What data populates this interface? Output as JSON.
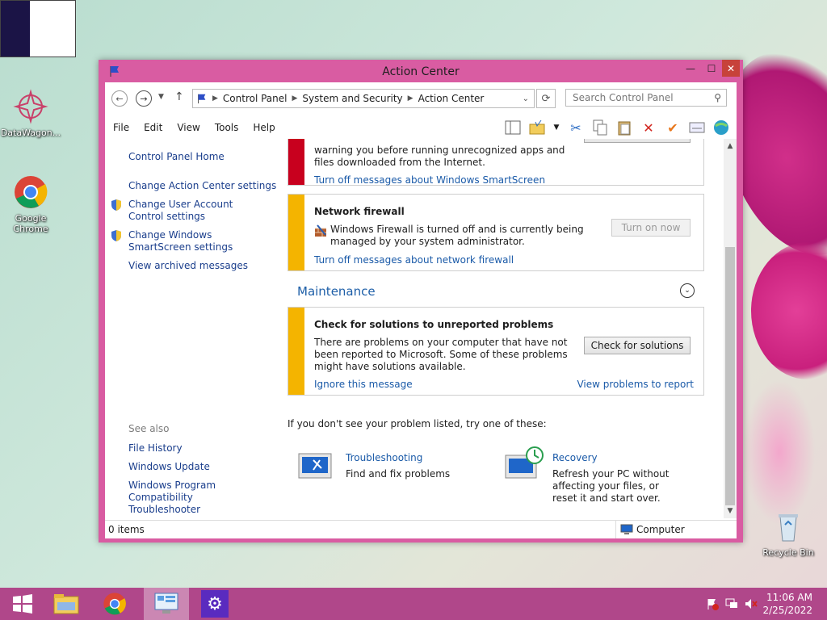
{
  "desktop": {
    "icons": [
      {
        "label": "DataWagon..."
      },
      {
        "label": "Google Chrome"
      },
      {
        "label": "Recycle Bin"
      }
    ]
  },
  "window": {
    "title": "Action Center",
    "controls": {
      "minimize": "—",
      "maximize": "☐",
      "close": "✕"
    },
    "address": {
      "segments": [
        "Control Panel",
        "System and Security",
        "Action Center"
      ],
      "search_placeholder": "Search Control Panel"
    },
    "menu": [
      "File",
      "Edit",
      "View",
      "Tools",
      "Help"
    ],
    "sidebar": {
      "home": "Control Panel Home",
      "links": [
        "Change Action Center settings",
        "Change User Account Control settings",
        "Change Windows SmartScreen settings",
        "View archived messages"
      ],
      "see_also_label": "See also",
      "see_also": [
        "File History",
        "Windows Update",
        "Windows Program Compatibility Troubleshooter"
      ]
    },
    "smartscreen_card": {
      "text": "warning you before running unrecognized apps and files downloaded from the Internet.",
      "link": "Turn off messages about Windows SmartScreen"
    },
    "firewall_card": {
      "heading": "Network firewall",
      "text": "Windows Firewall is turned off and is currently being managed by your system administrator.",
      "button": "Turn on now",
      "link": "Turn off messages about network firewall"
    },
    "maintenance": {
      "heading": "Maintenance",
      "card": {
        "heading": "Check for solutions to unreported problems",
        "text": "There are problems on your computer that have not been reported to Microsoft. Some of these problems might have solutions available.",
        "button": "Check for solutions",
        "ignore_link": "Ignore this message",
        "view_link": "View problems to report"
      }
    },
    "try_text": "If you don't see your problem listed, try one of these:",
    "troubleshooting": {
      "title": "Troubleshooting",
      "desc": "Find and fix problems"
    },
    "recovery": {
      "title": "Recovery",
      "desc": "Refresh your PC without affecting your files, or reset it and start over."
    },
    "status": {
      "items": "0 items",
      "location": "Computer"
    }
  },
  "taskbar": {
    "time": "11:06 AM",
    "date": "2/25/2022"
  },
  "colors": {
    "window_frame": "#d95ca2",
    "taskbar": "#b0478a",
    "critical": "#c8001e",
    "warning": "#f4b400",
    "link": "#1a5aa8"
  }
}
